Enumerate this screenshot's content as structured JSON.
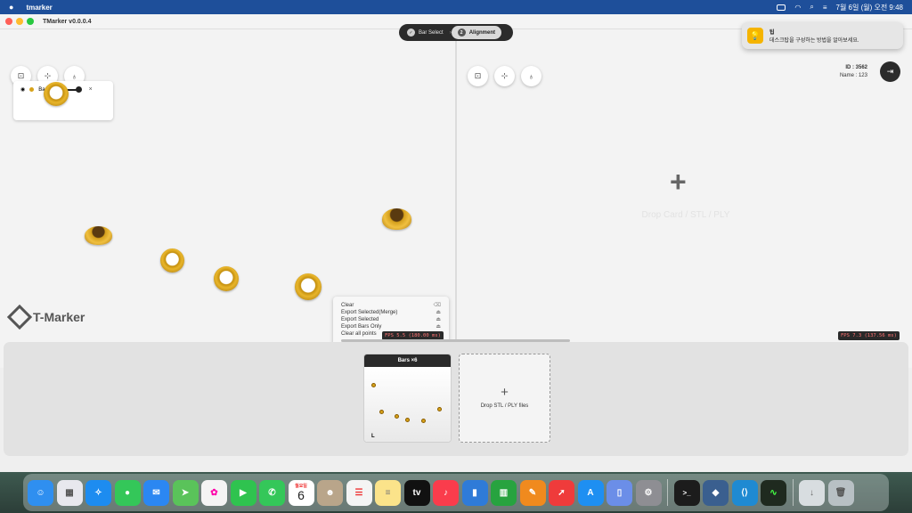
{
  "menubar": {
    "apple": "",
    "app": "tmarker",
    "clock": "7월 6일 (월) 오전 9:48"
  },
  "window": {
    "title": "TMarker  v0.0.0.4"
  },
  "steps": [
    {
      "num": "✓",
      "label": "Bar Select"
    },
    {
      "num": "2",
      "label": "Alignment"
    }
  ],
  "layers": {
    "name": "Bars",
    "close": "×"
  },
  "logo": "T-Marker",
  "context_menu": [
    {
      "label": "Clear",
      "shortcut": "⌫"
    },
    {
      "label": "Export Selected(Merge)",
      "shortcut": "⏏"
    },
    {
      "label": "Export Selected",
      "shortcut": "⏏"
    },
    {
      "label": "Export Bars Only",
      "shortcut": "⏏"
    },
    {
      "label": "Clear all points",
      "shortcut": ""
    }
  ],
  "fps_left": "FPS 5.5  (180.00 ms)",
  "fps_right": "FPS 7.3  (137.56 ms)",
  "right_viewport": {
    "id": "ID : 3562",
    "name": "Name : 123",
    "plus": "+",
    "hint": "Drop Card / STL / PLY"
  },
  "notification": {
    "icon": "💡",
    "title": "팁",
    "body": "데스크탑을 구성하는 방법을 알아보세요."
  },
  "tray": {
    "card_title": "Bars  ×6",
    "card_corner": "L",
    "drop_plus": "+",
    "drop_label": "Drop STL / PLY files"
  },
  "dock": {
    "calendar_month": "월요일",
    "calendar_day": "6",
    "colors": {
      "finder": "#2f8ff0",
      "launchpad": "#e8e8ee",
      "safari": "#1d8cf0",
      "messages": "#34c759",
      "mail": "#2b87f2",
      "maps": "#5ac35a",
      "photos": "#f4f4f4",
      "facetime": "#2fc34f",
      "phone": "#34c759",
      "calendar": "#ffffff",
      "contacts": "#b9a58a",
      "reminders": "#f4f4f4",
      "notes": "#fbe38a",
      "tv": "#111111",
      "music": "#fa3c4c",
      "keynote": "#2f7bd8",
      "numbers": "#27a33f",
      "pages": "#f08a1e",
      "rocket": "#ef3b3b",
      "appstore": "#1e8ff2",
      "simulator": "#6b8ee8",
      "settings": "#8e8e93",
      "terminal": "#1c1c1c",
      "tmarker": "#3a5f8f",
      "vscode": "#1f8ad2",
      "activity": "#1f2a1f",
      "downloads": "#d8dde0",
      "trash": "#b8c0c4"
    }
  }
}
